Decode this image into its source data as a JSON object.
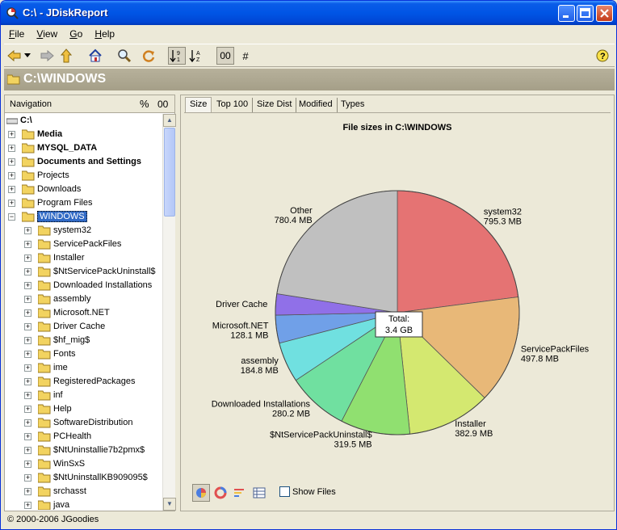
{
  "window": {
    "title": "C:\\ - JDiskReport"
  },
  "menu": [
    {
      "label": "File",
      "accel": "F",
      "rest": "ile"
    },
    {
      "label": "View",
      "accel": "V",
      "rest": "iew"
    },
    {
      "label": "Go",
      "accel": "G",
      "rest": "o"
    },
    {
      "label": "Help",
      "accel": "H",
      "rest": "elp"
    }
  ],
  "toolbar": {
    "numbers_label": "00",
    "hash_label": "#"
  },
  "path": {
    "current": "C:\\WINDOWS"
  },
  "navigation": {
    "title": "Navigation",
    "percent_label": "%",
    "size_label": "00",
    "root": "C:\\",
    "items": [
      {
        "label": "Media",
        "bold": true
      },
      {
        "label": "MYSQL_DATA",
        "bold": true
      },
      {
        "label": "Documents and Settings",
        "bold": true
      },
      {
        "label": "Projects",
        "bold": false
      },
      {
        "label": "Downloads",
        "bold": false
      },
      {
        "label": "Program Files",
        "bold": false
      },
      {
        "label": "WINDOWS",
        "bold": false,
        "selected": true
      }
    ],
    "children": [
      "system32",
      "ServicePackFiles",
      "Installer",
      "$NtServicePackUninstall$",
      "Downloaded Installations",
      "assembly",
      "Microsoft.NET",
      "Driver Cache",
      "$hf_mig$",
      "Fonts",
      "ime",
      "RegisteredPackages",
      "inf",
      "Help",
      "SoftwareDistribution",
      "PCHealth",
      "$NtUninstallie7b2pmx$",
      "WinSxS",
      "$NtUninstallKB909095$",
      "srchasst",
      "java"
    ]
  },
  "tabs": [
    "Size",
    "Top 100",
    "Size Dist",
    "Modified",
    "Types"
  ],
  "chart_data": {
    "type": "pie",
    "title": "File sizes in C:\\WINDOWS",
    "unit": "MB",
    "total_label": "Total:",
    "total_value": "3.4 GB",
    "slices": [
      {
        "name": "system32",
        "value": 795.3,
        "display": "795.3 MB",
        "color": "#e57373"
      },
      {
        "name": "ServicePackFiles",
        "value": 497.8,
        "display": "497.8 MB",
        "color": "#e8b878"
      },
      {
        "name": "Installer",
        "value": 382.9,
        "display": "382.9 MB",
        "color": "#d4e870"
      },
      {
        "name": "$NtServicePackUninstall$",
        "value": 319.5,
        "display": "319.5 MB",
        "color": "#90e070"
      },
      {
        "name": "Downloaded Installations",
        "value": 280.2,
        "display": "280.2 MB",
        "color": "#70e0a0"
      },
      {
        "name": "assembly",
        "value": 184.8,
        "display": "184.8 MB",
        "color": "#70e0e0"
      },
      {
        "name": "Microsoft.NET",
        "value": 128.1,
        "display": "128.1 MB",
        "color": "#70a0e8"
      },
      {
        "name": "Driver Cache",
        "value": 97.5,
        "display": "",
        "color": "#9070e8"
      },
      {
        "name": "Other",
        "value": 780.4,
        "display": "780.4 MB",
        "color": "#c0c0c0"
      }
    ]
  },
  "bottom": {
    "show_files_label": "Show Files",
    "show_files_checked": false
  },
  "status": {
    "text": "© 2000-2006 JGoodies"
  }
}
